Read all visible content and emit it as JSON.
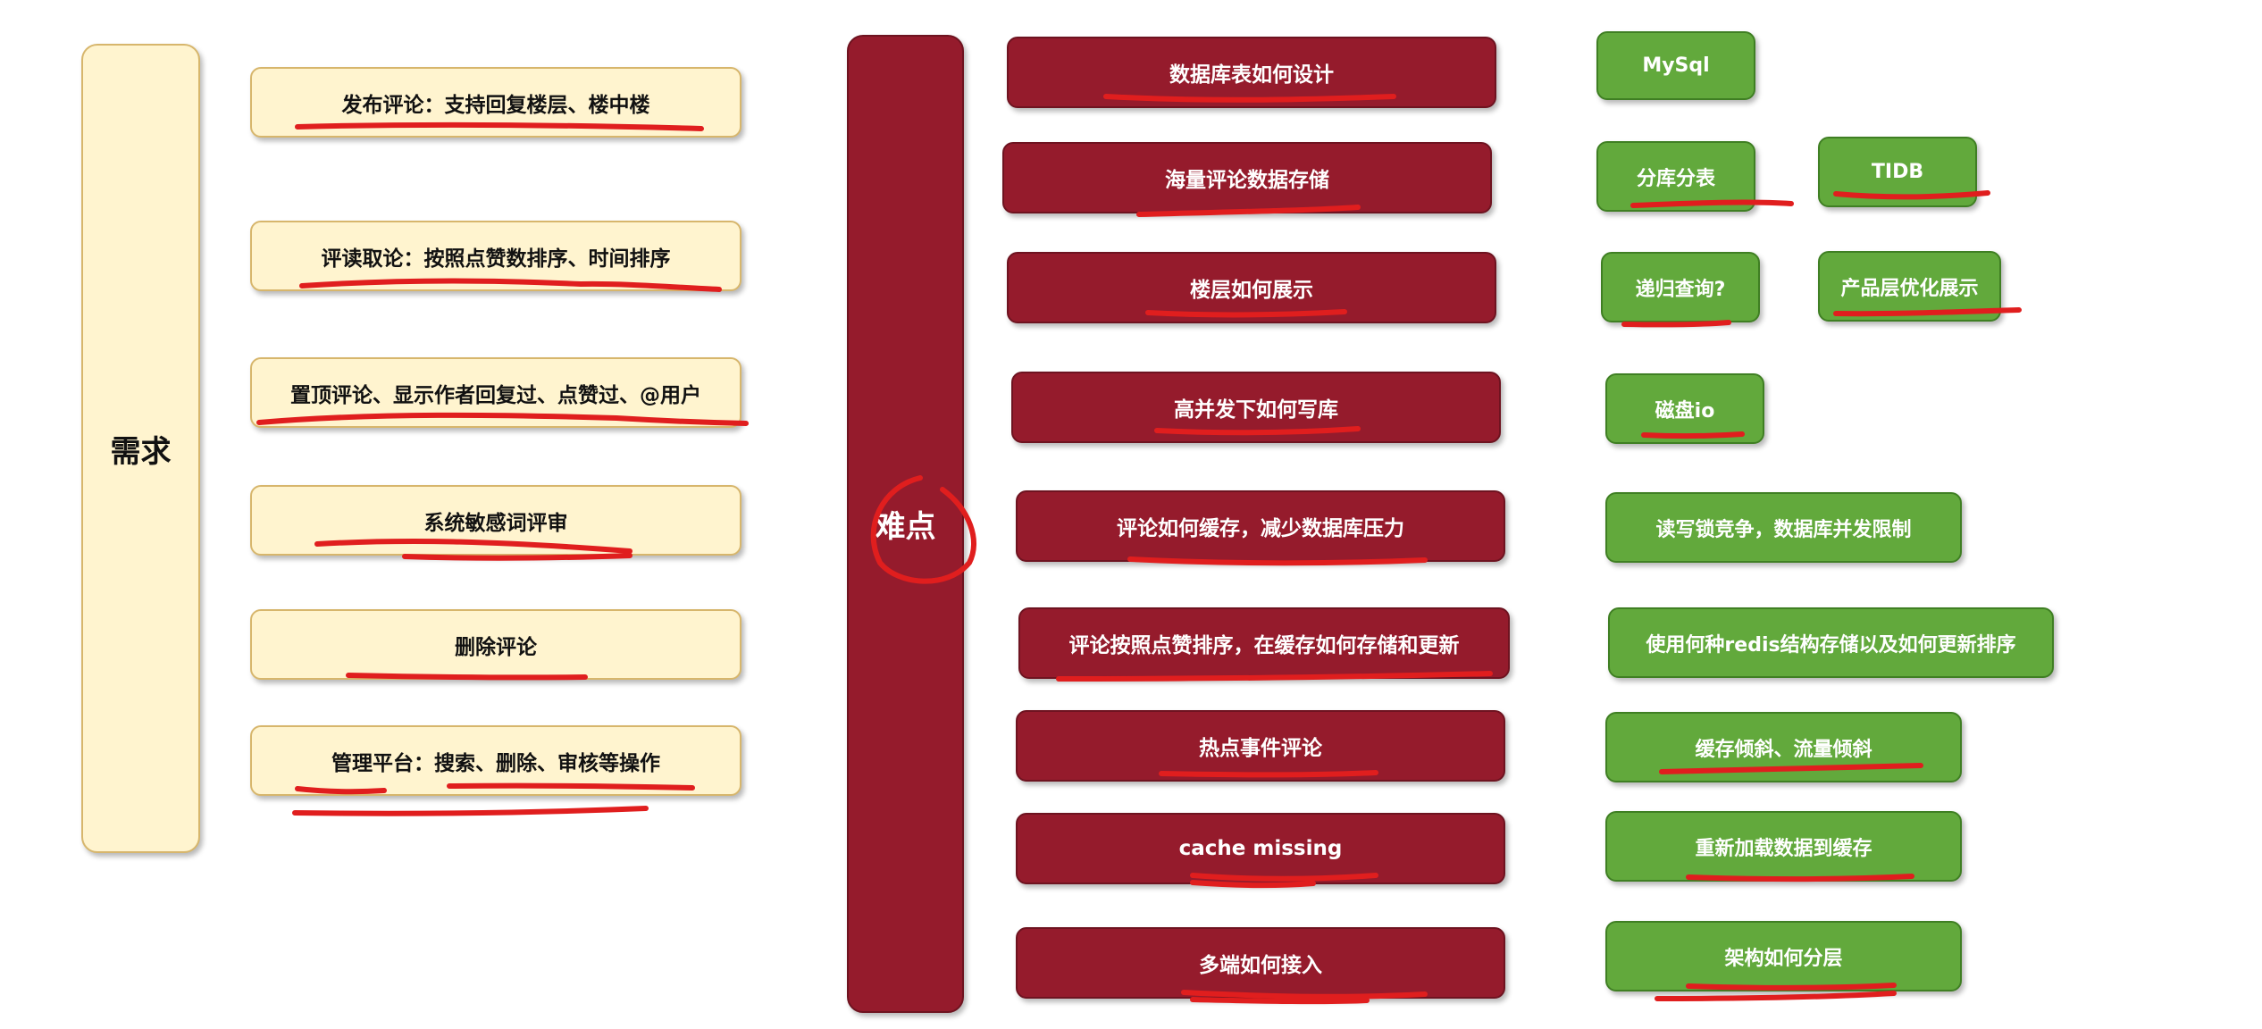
{
  "requirements": {
    "title": "需求",
    "items": [
      "发布评论：支持回复楼层、楼中楼",
      "评读取论：按照点赞数排序、时间排序",
      "置顶评论、显示作者回复过、点赞过、@用户",
      "系统敏感词评审",
      "删除评论",
      "管理平台：搜索、删除、审核等操作"
    ]
  },
  "difficulties": {
    "title": "难点",
    "items": [
      "数据库表如何设计",
      "海量评论数据存储",
      "楼层如何展示",
      "高并发下如何写库",
      "评论如何缓存，减少数据库压力",
      "评论按照点赞排序，在缓存如何存储和更新",
      "热点事件评论",
      "cache missing",
      "多端如何接入"
    ]
  },
  "solutions": {
    "items": [
      "MySql",
      "分库分表",
      "TIDB",
      "递归查询?",
      "产品层优化展示",
      "磁盘io",
      "读写锁竞争，数据库并发限制",
      "使用何种redis结构存储以及如何更新排序",
      "缓存倾斜、流量倾斜",
      "重新加载数据到缓存",
      "架构如何分层"
    ]
  },
  "colors": {
    "cream": "#fff4cf",
    "dark_red": "#951b2c",
    "green": "#62a93c",
    "annotation_red": "#e01e1e"
  }
}
